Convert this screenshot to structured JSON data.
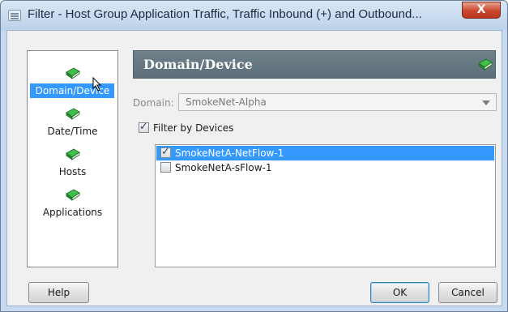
{
  "window": {
    "title": "Filter - Host Group Application Traffic, Traffic Inbound (+) and Outbound...",
    "close_label": "X"
  },
  "nav": {
    "items": [
      {
        "label": "Domain/Device",
        "icon": "book-icon",
        "selected": true
      },
      {
        "label": "Date/Time",
        "icon": "book-icon",
        "selected": false
      },
      {
        "label": "Hosts",
        "icon": "book-icon",
        "selected": false
      },
      {
        "label": "Applications",
        "icon": "book-icon",
        "selected": false
      }
    ]
  },
  "panel": {
    "title": "Domain/Device",
    "domain_label": "Domain:",
    "domain_value": "SmokeNet-Alpha",
    "filter_by_devices_label": "Filter by Devices",
    "filter_by_devices_checked": true,
    "devices": [
      {
        "label": "SmokeNetA-NetFlow-1",
        "checked": true,
        "selected": true
      },
      {
        "label": "SmokeNetA-sFlow-1",
        "checked": false,
        "selected": false
      }
    ]
  },
  "buttons": {
    "help": "Help",
    "ok": "OK",
    "cancel": "Cancel"
  },
  "colors": {
    "selection": "#3399ff",
    "header": "#64767f",
    "book_green": "#2e9a3a"
  }
}
